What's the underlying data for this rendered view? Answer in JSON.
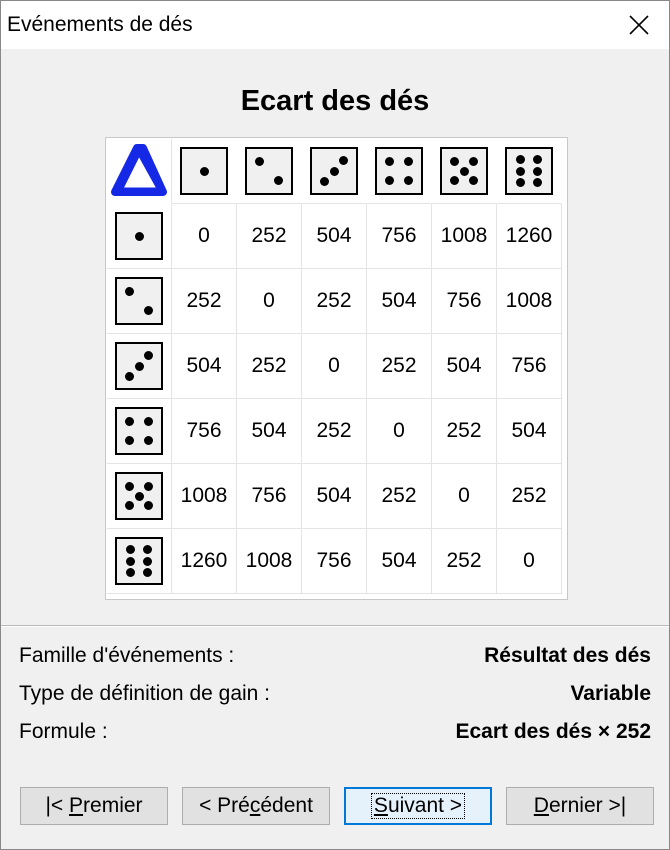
{
  "window": {
    "title": "Evénements de dés",
    "close_icon": "close-icon"
  },
  "heading": "Ecart des dés",
  "table": {
    "corner_symbol": "Δ",
    "corner_color": "#1428e6",
    "header_faces": [
      1,
      2,
      3,
      4,
      5,
      6
    ],
    "rows": [
      {
        "face": 1,
        "values": [
          "0",
          "252",
          "504",
          "756",
          "1008",
          "1260"
        ]
      },
      {
        "face": 2,
        "values": [
          "252",
          "0",
          "252",
          "504",
          "756",
          "1008"
        ]
      },
      {
        "face": 3,
        "values": [
          "504",
          "252",
          "0",
          "252",
          "504",
          "756"
        ]
      },
      {
        "face": 4,
        "values": [
          "756",
          "504",
          "252",
          "0",
          "252",
          "504"
        ]
      },
      {
        "face": 5,
        "values": [
          "1008",
          "756",
          "504",
          "252",
          "0",
          "252"
        ]
      },
      {
        "face": 6,
        "values": [
          "1260",
          "1008",
          "756",
          "504",
          "252",
          "0"
        ]
      }
    ]
  },
  "info": {
    "family_label": "Famille d'événements :",
    "family_value": "Résultat des dés",
    "type_label": "Type de définition de gain :",
    "type_value": "Variable",
    "formula_label": "Formule :",
    "formula_value": "Ecart des dés × 252"
  },
  "buttons": {
    "first_pre": "|< ",
    "first_mn": "P",
    "first_post": "remier",
    "prev_pre": "< Pré",
    "prev_mn": "c",
    "prev_post": "édent",
    "next_pre": "",
    "next_mn": "S",
    "next_post": "uivant >",
    "last_pre": "",
    "last_mn": "D",
    "last_post": "ernier >|"
  }
}
